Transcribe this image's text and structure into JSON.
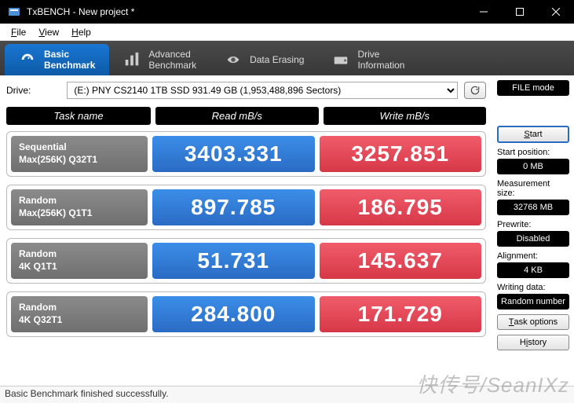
{
  "window": {
    "title": "TxBENCH - New project *"
  },
  "menu": {
    "file": "File",
    "view": "View",
    "help": "Help"
  },
  "tabs": {
    "basic": "Basic\nBenchmark",
    "advanced": "Advanced\nBenchmark",
    "erase": "Data Erasing",
    "drive": "Drive\nInformation"
  },
  "drive": {
    "label": "Drive:",
    "selected": "(E:) PNY CS2140 1TB SSD  931.49 GB (1,953,488,896 Sectors)"
  },
  "headers": {
    "task": "Task name",
    "read": "Read mB/s",
    "write": "Write mB/s"
  },
  "rows": [
    {
      "name1": "Sequential",
      "name2": "Max(256K) Q32T1",
      "read": "3403.331",
      "write": "3257.851"
    },
    {
      "name1": "Random",
      "name2": "Max(256K) Q1T1",
      "read": "897.785",
      "write": "186.795"
    },
    {
      "name1": "Random",
      "name2": "4K Q1T1",
      "read": "51.731",
      "write": "145.637"
    },
    {
      "name1": "Random",
      "name2": "4K Q32T1",
      "read": "284.800",
      "write": "171.729"
    }
  ],
  "side": {
    "filemode": "FILE mode",
    "start": "Start",
    "startpos_label": "Start position:",
    "startpos": "0 MB",
    "meassize_label": "Measurement size:",
    "meassize": "32768 MB",
    "prewrite_label": "Prewrite:",
    "prewrite": "Disabled",
    "align_label": "Alignment:",
    "align": "4 KB",
    "writedata_label": "Writing data:",
    "writedata": "Random number",
    "taskopt": "Task options",
    "history": "History"
  },
  "status": "Basic Benchmark finished successfully.",
  "watermark": "快传号/SeanIXz"
}
